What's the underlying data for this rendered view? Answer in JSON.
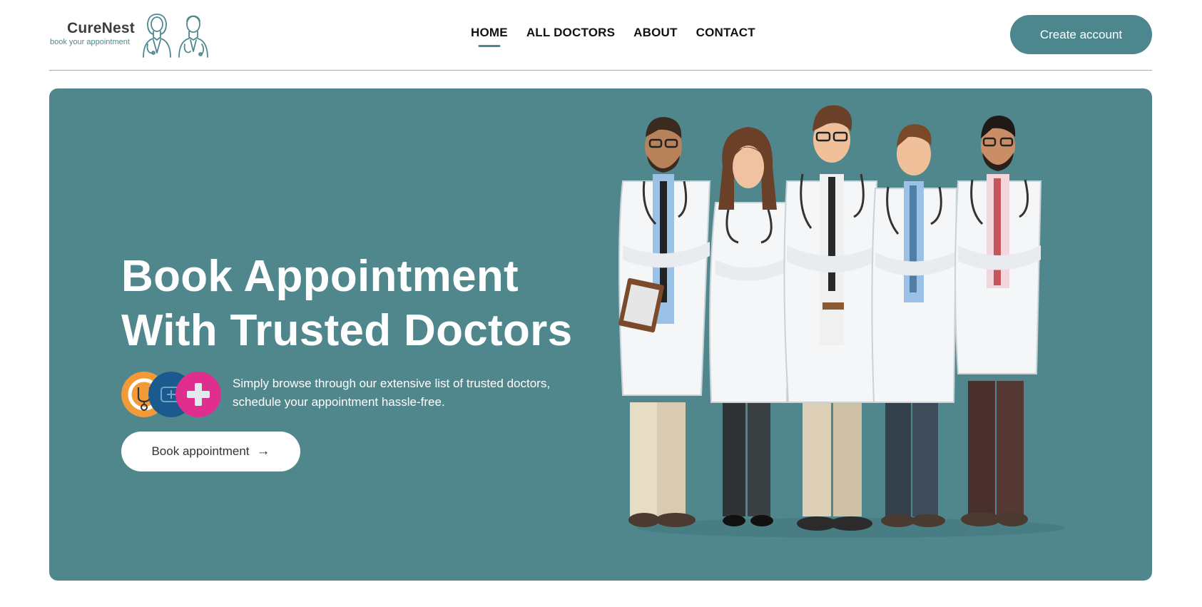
{
  "brand": {
    "name": "CureNest",
    "tagline": "book your appointment"
  },
  "nav": {
    "items": [
      {
        "label": "HOME",
        "active": true
      },
      {
        "label": "ALL DOCTORS",
        "active": false
      },
      {
        "label": "ABOUT",
        "active": false
      },
      {
        "label": "CONTACT",
        "active": false
      }
    ]
  },
  "header": {
    "cta_label": "Create account"
  },
  "hero": {
    "title_line1": "Book Appointment",
    "title_line2": "With Trusted Doctors",
    "subtitle_line1": "Simply browse through our extensive list of trusted doctors,",
    "subtitle_line2": "schedule your appointment hassle-free.",
    "button_label": "Book appointment",
    "button_icon": "arrow-right-icon",
    "badges": [
      {
        "icon": "stethoscope-icon",
        "color": "#f29a38"
      },
      {
        "icon": "medical-card-icon",
        "color": "#1a5a8f"
      },
      {
        "icon": "medical-plus-icon",
        "color": "#e02e8f"
      }
    ],
    "illustration": "group-of-doctors-illustration"
  },
  "colors": {
    "accent": "#4b878d",
    "hero_bg": "#4f878c",
    "text_dark": "#111111"
  }
}
